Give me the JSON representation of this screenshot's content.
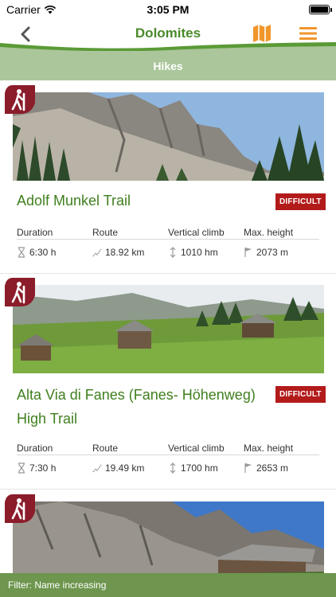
{
  "status": {
    "carrier": "Carrier",
    "time": "3:05 PM",
    "battery_level": 1.0
  },
  "nav": {
    "title": "Dolomites",
    "back_icon": "chevron-left-icon",
    "map_icon": "map-icon",
    "menu_icon": "menu-icon"
  },
  "section": {
    "title": "Hikes"
  },
  "stat_labels": {
    "duration": "Duration",
    "route": "Route",
    "vertical_climb": "Vertical climb",
    "max_height": "Max. height"
  },
  "hikes": [
    {
      "title": "Adolf Munkel Trail",
      "difficulty": "DIFFICULT",
      "duration": "6:30 h",
      "route": "18.92 km",
      "vertical_climb": "1010 hm",
      "max_height": "2073 m"
    },
    {
      "title": "Alta Via di Fanes (Fanes- Höhenweg) High Trail",
      "difficulty": "DIFFICULT",
      "duration": "7:30 h",
      "route": "19.49 km",
      "vertical_climb": "1700 hm",
      "max_height": "2653 m"
    },
    {
      "title": "",
      "difficulty": "",
      "duration": "",
      "route": "",
      "vertical_climb": "",
      "max_height": ""
    }
  ],
  "filter": {
    "label": "Filter: Name increasing"
  },
  "colors": {
    "brand_green": "#4a8a2a",
    "section_green": "#aac69a",
    "filter_green": "#6e964e",
    "difficulty_red": "#b31b1b",
    "badge_red": "#8b1c2a",
    "nav_orange": "#f0962a"
  }
}
